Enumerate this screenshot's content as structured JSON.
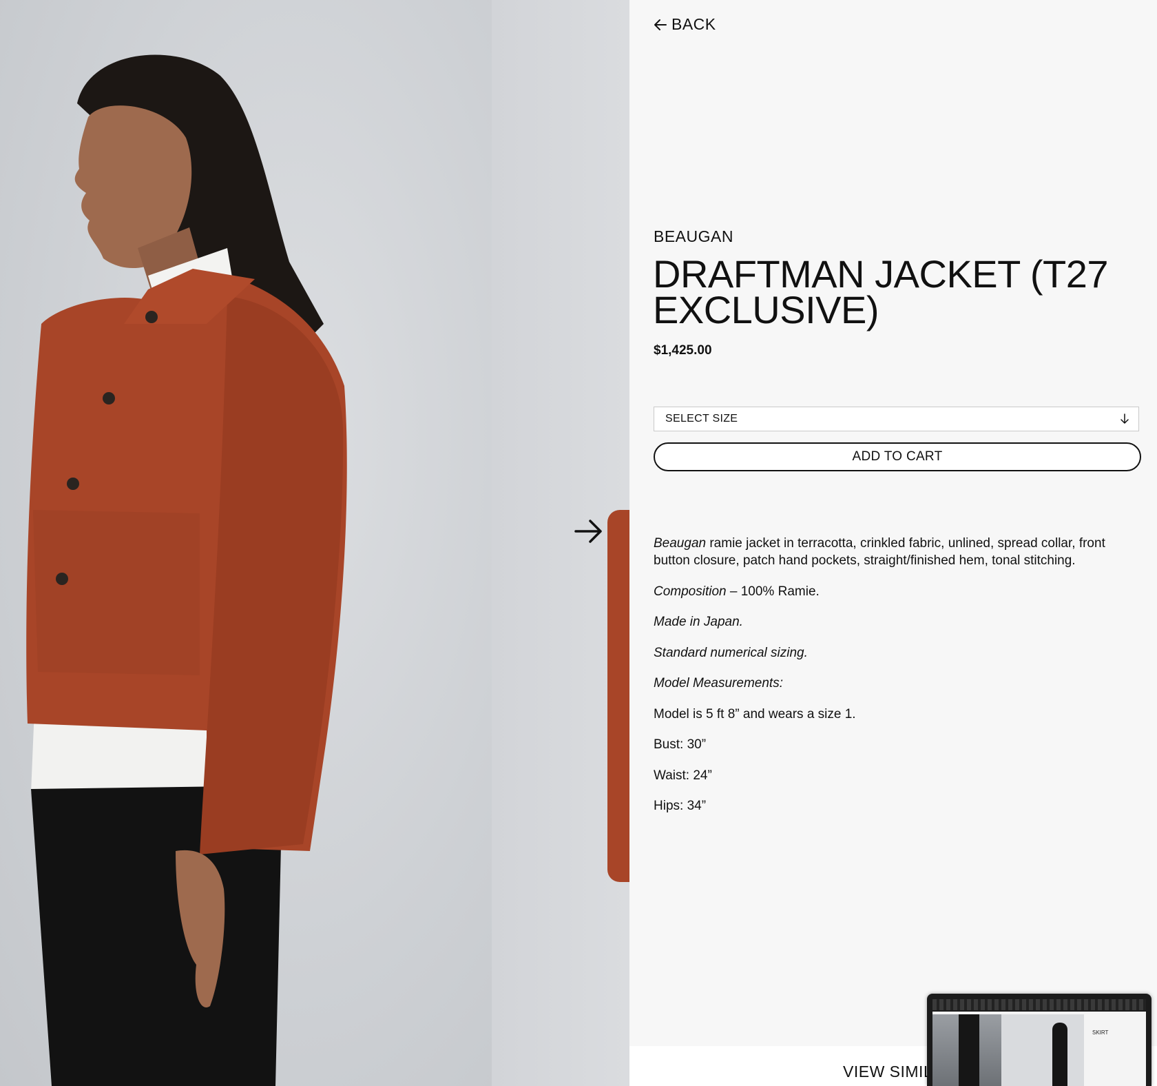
{
  "navigation": {
    "back_label": "BACK"
  },
  "product": {
    "brand": "BEAUGAN",
    "title": "DRAFTMAN JACKET (T27 EXCLUSIVE)",
    "price": "$1,425.00",
    "size_select_label": "SELECT SIZE",
    "add_to_cart_label": "ADD TO CART"
  },
  "description": {
    "intro_brand": "Beaugan",
    "intro_text": " ramie jacket in terracotta, crinkled fabric, unlined, spread collar, front button closure, patch hand pockets, straight/finished hem, tonal stitching.",
    "composition_label": "Composition",
    "composition_value": " – 100% Ramie.",
    "made_in": "Made in Japan.",
    "sizing": "Standard numerical sizing.",
    "model_heading": "Model Measurements:",
    "model_info": "Model is 5 ft 8” and wears a size 1.",
    "bust": "Bust: 30”",
    "waist": "Waist: 24”",
    "hips": "Hips: 34”"
  },
  "footer": {
    "view_similar_label": "VIEW SIMIL"
  },
  "thumbnail": {
    "title": "SKIRT"
  },
  "icons": {
    "back": "arrow-left-icon",
    "next": "arrow-right-icon",
    "select": "arrow-down-icon"
  },
  "colors": {
    "jacket": "#a84528",
    "background": "#f7f7f7",
    "text": "#111111"
  }
}
